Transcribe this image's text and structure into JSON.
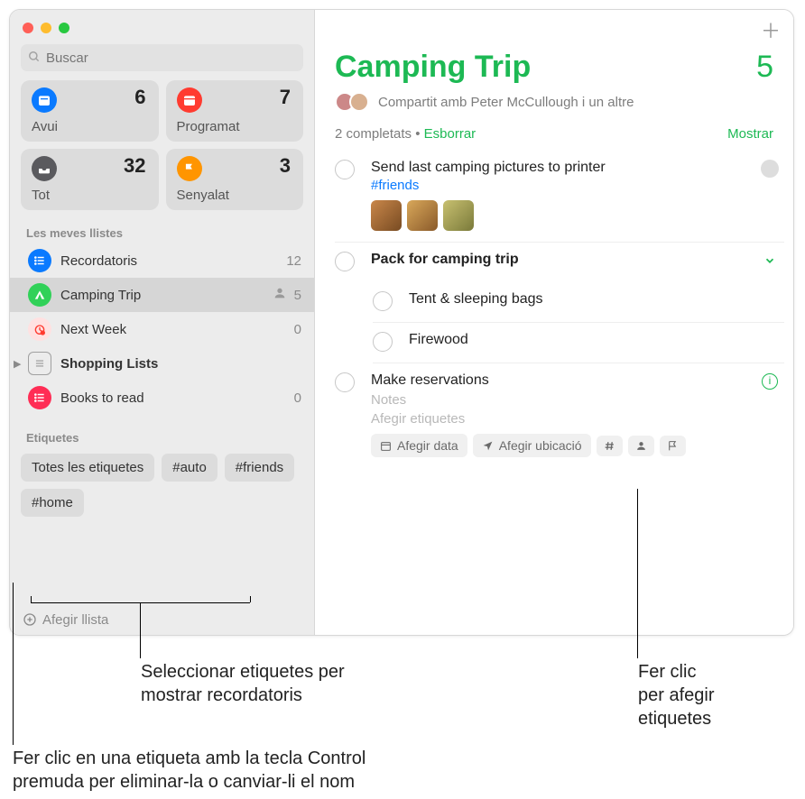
{
  "search": {
    "placeholder": "Buscar"
  },
  "smart": [
    {
      "label": "Avui",
      "count": 6,
      "icon": "calendar-today-icon",
      "color": "ic-blue"
    },
    {
      "label": "Programat",
      "count": 7,
      "icon": "calendar-icon",
      "color": "ic-red"
    },
    {
      "label": "Tot",
      "count": 32,
      "icon": "tray-icon",
      "color": "ic-grey"
    },
    {
      "label": "Senyalat",
      "count": 3,
      "icon": "flag-icon",
      "color": "ic-orange"
    }
  ],
  "sections": {
    "mylists": "Les meves llistes",
    "tags": "Etiquetes"
  },
  "lists": [
    {
      "name": "Recordatoris",
      "count": 12,
      "icon": "list-icon",
      "color": "li-blue"
    },
    {
      "name": "Camping Trip",
      "count": 5,
      "icon": "tent-icon",
      "color": "li-green",
      "selected": true,
      "shared": true
    },
    {
      "name": "Next Week",
      "count": 0,
      "icon": "alarm-icon",
      "color": "li-red"
    },
    {
      "name": "Shopping Lists",
      "count": "",
      "icon": "folder-icon",
      "color": "outline",
      "bold": true,
      "chevron": true
    },
    {
      "name": "Books to read",
      "count": 0,
      "icon": "list-icon",
      "color": "li-pink"
    }
  ],
  "tags": [
    "Totes les etiquetes",
    "#auto",
    "#friends",
    "#home"
  ],
  "addList": "Afegir llista",
  "main": {
    "title": "Camping Trip",
    "count": 5,
    "sharedWith": "Compartit amb Peter McCullough i un altre",
    "completedText": "2 completats",
    "clear": "Esborrar",
    "show": "Mostrar"
  },
  "reminders": {
    "r0": {
      "title": "Send last camping pictures to printer",
      "tag": "#friends"
    },
    "r1": {
      "title": "Pack for camping trip"
    },
    "r1a": {
      "title": "Tent & sleeping bags"
    },
    "r1b": {
      "title": "Firewood"
    },
    "r2": {
      "title": "Make reservations",
      "notes": "Notes",
      "tagsPh": "Afegir etiquetes"
    }
  },
  "quickbar": {
    "date": "Afegir data",
    "location": "Afegir ubicació"
  },
  "callouts": {
    "c1": "Seleccionar etiquetes per\nmostrar recordatoris",
    "c2": "Fer clic\nper afegir\netiquetes",
    "c3": "Fer clic en una etiqueta amb la tecla Control\npremuda per eliminar-la o canviar-li el nom"
  }
}
